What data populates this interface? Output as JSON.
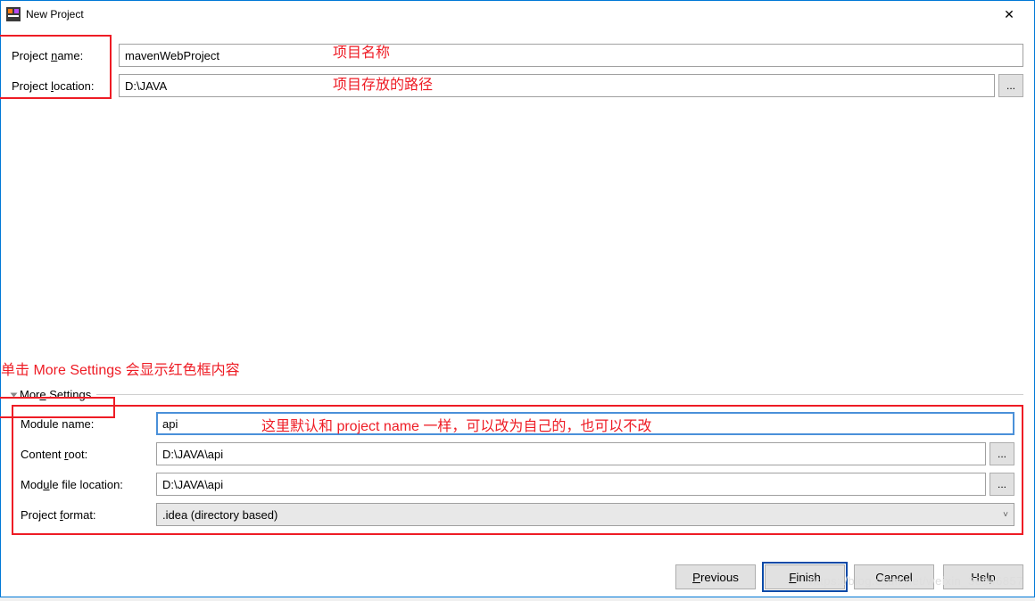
{
  "window": {
    "title": "New Project",
    "close_glyph": "✕"
  },
  "fields": {
    "project_name_label_pre": "Project ",
    "project_name_label_u": "n",
    "project_name_label_post": "ame:",
    "project_name_value": "mavenWebProject",
    "project_location_label_pre": "Project ",
    "project_location_label_u": "l",
    "project_location_label_post": "ocation:",
    "project_location_value": "D:\\JAVA",
    "browse_label": "..."
  },
  "more": {
    "hint": "单击 More Settings 会显示红色框内容",
    "header_pre": "Mor",
    "header_u": "e",
    "header_post": " Settings",
    "module_name_label": "Module name:",
    "module_name_value": "api",
    "module_name_annot": "这里默认和 project name 一样，可以改为自己的，也可以不改",
    "content_root_label_pre": "Content ",
    "content_root_label_u": "r",
    "content_root_label_post": "oot:",
    "content_root_value": "D:\\JAVA\\api",
    "module_file_label_pre": "Mod",
    "module_file_label_u": "u",
    "module_file_label_post": "le file location:",
    "module_file_value": "D:\\JAVA\\api",
    "project_format_label_pre": "Project ",
    "project_format_label_u": "f",
    "project_format_label_post": "ormat:",
    "project_format_value": ".idea (directory based)"
  },
  "annot": {
    "name": "项目名称",
    "location": "项目存放的路径"
  },
  "buttons": {
    "previous_u": "P",
    "previous_post": "revious",
    "finish_u": "F",
    "finish_post": "inish",
    "cancel": "Cancel",
    "help": "Help"
  },
  "watermark": "https://blog.csdn.net/weixin_38946857"
}
